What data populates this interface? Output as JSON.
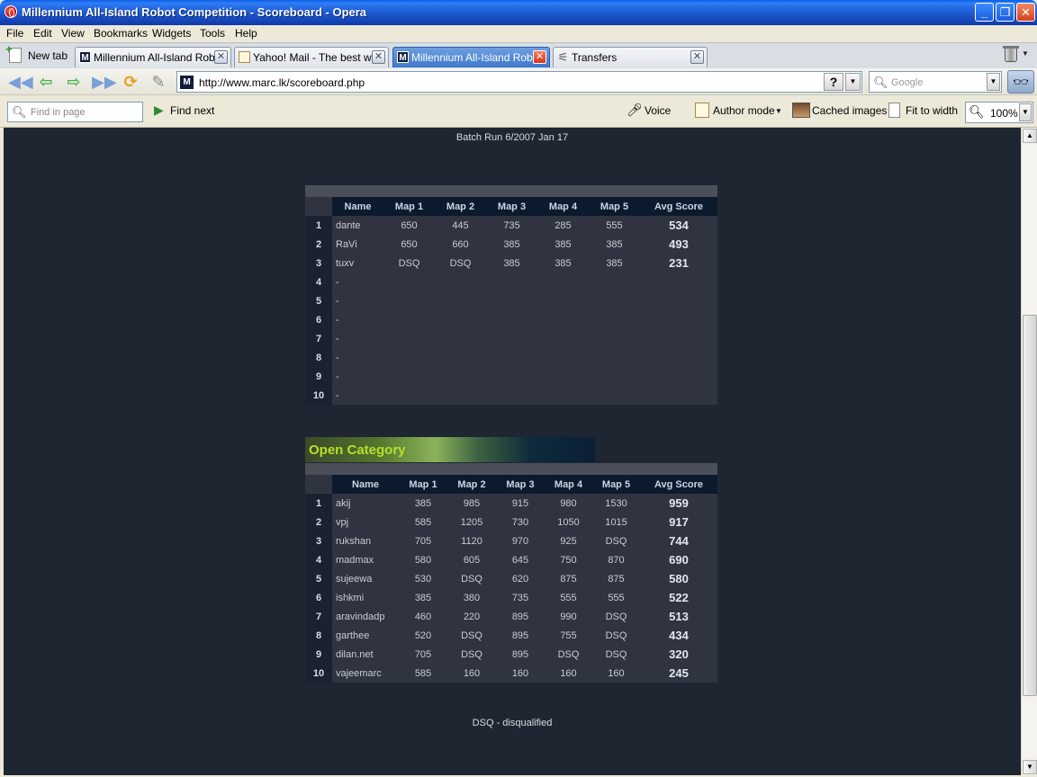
{
  "window": {
    "title": "Millennium All-Island Robot Competition - Scoreboard - Opera",
    "min_label": "_",
    "max_label": "❐",
    "close_label": "✕"
  },
  "menu": [
    "File",
    "Edit",
    "View",
    "Bookmarks",
    "Widgets",
    "Tools",
    "Help"
  ],
  "tabs": {
    "new_tab_label": "New tab",
    "items": [
      {
        "label": "Millennium All-Island Rob...",
        "icon": "M",
        "active": false
      },
      {
        "label": "Yahoo! Mail - The best w...",
        "icon": "page",
        "active": false
      },
      {
        "label": "Millennium All-Island Rob...",
        "icon": "M",
        "active": true
      },
      {
        "label": "Transfers",
        "icon": "transfers",
        "active": false
      }
    ],
    "close_glyph": "✕"
  },
  "nav": {
    "url": "http://www.marc.lk/scoreboard.php",
    "help_label": "?",
    "search_placeholder": "Google",
    "site_icon_letter": "M"
  },
  "viewbar": {
    "find_placeholder": "Find in page",
    "find_next": "Find next",
    "voice": "Voice",
    "author_mode": "Author mode",
    "cached_images": "Cached images",
    "fit_to_width": "Fit to width",
    "zoom": "100%"
  },
  "page": {
    "batch_run": "Batch Run 6/2007 Jan 17",
    "footnote": "DSQ - disqualified",
    "headers": [
      "Name",
      "Map 1",
      "Map 2",
      "Map 3",
      "Map 4",
      "Map 5",
      "Avg Score"
    ],
    "board1": {
      "rows": [
        {
          "rank": "1",
          "name": "dante",
          "m1": "650",
          "m2": "445",
          "m3": "735",
          "m4": "285",
          "m5": "555",
          "avg": "534"
        },
        {
          "rank": "2",
          "name": "RaVi",
          "m1": "650",
          "m2": "660",
          "m3": "385",
          "m4": "385",
          "m5": "385",
          "avg": "493"
        },
        {
          "rank": "3",
          "name": "tuxv",
          "m1": "DSQ",
          "m2": "DSQ",
          "m3": "385",
          "m4": "385",
          "m5": "385",
          "avg": "231"
        },
        {
          "rank": "4",
          "name": "-"
        },
        {
          "rank": "5",
          "name": "-"
        },
        {
          "rank": "6",
          "name": "-"
        },
        {
          "rank": "7",
          "name": "-"
        },
        {
          "rank": "8",
          "name": "-"
        },
        {
          "rank": "9",
          "name": "-"
        },
        {
          "rank": "10",
          "name": "-"
        }
      ]
    },
    "open_category": {
      "title": "Open Category",
      "rows": [
        {
          "rank": "1",
          "name": "akij",
          "m1": "385",
          "m2": "985",
          "m3": "915",
          "m4": "980",
          "m5": "1530",
          "avg": "959"
        },
        {
          "rank": "2",
          "name": "vpj",
          "m1": "585",
          "m2": "1205",
          "m3": "730",
          "m4": "1050",
          "m5": "1015",
          "avg": "917"
        },
        {
          "rank": "3",
          "name": "rukshan",
          "m1": "705",
          "m2": "1120",
          "m3": "970",
          "m4": "925",
          "m5": "DSQ",
          "avg": "744"
        },
        {
          "rank": "4",
          "name": "madmax",
          "m1": "580",
          "m2": "605",
          "m3": "645",
          "m4": "750",
          "m5": "870",
          "avg": "690"
        },
        {
          "rank": "5",
          "name": "sujeewa",
          "m1": "530",
          "m2": "DSQ",
          "m3": "620",
          "m4": "875",
          "m5": "875",
          "avg": "580"
        },
        {
          "rank": "6",
          "name": "ishkmi",
          "m1": "385",
          "m2": "380",
          "m3": "735",
          "m4": "555",
          "m5": "555",
          "avg": "522"
        },
        {
          "rank": "7",
          "name": "aravindadp",
          "m1": "460",
          "m2": "220",
          "m3": "895",
          "m4": "990",
          "m5": "DSQ",
          "avg": "513"
        },
        {
          "rank": "8",
          "name": "garthee",
          "m1": "520",
          "m2": "DSQ",
          "m3": "895",
          "m4": "755",
          "m5": "DSQ",
          "avg": "434"
        },
        {
          "rank": "9",
          "name": "dilan.net",
          "m1": "705",
          "m2": "DSQ",
          "m3": "895",
          "m4": "DSQ",
          "m5": "DSQ",
          "avg": "320"
        },
        {
          "rank": "10",
          "name": "vajeemarc",
          "m1": "585",
          "m2": "160",
          "m3": "160",
          "m4": "160",
          "m5": "160",
          "avg": "245"
        }
      ]
    }
  }
}
